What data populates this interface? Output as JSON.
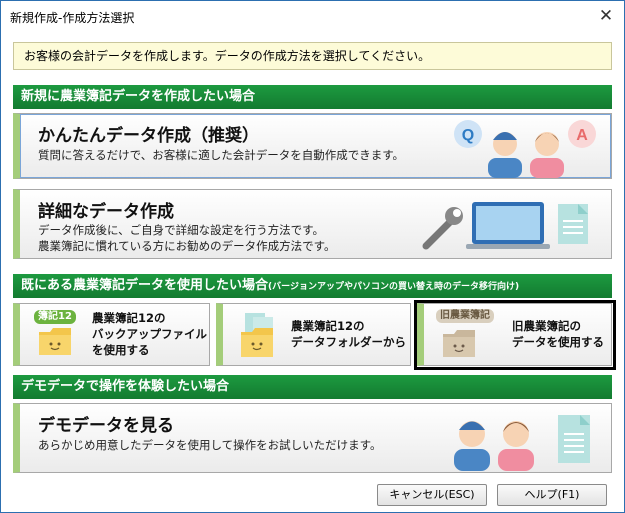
{
  "window": {
    "title": "新規作成-作成方法選択"
  },
  "info_text": "お客様の会計データを作成します。データの作成方法を選択してください。",
  "sections": {
    "new": "新規に農業簿記データを作成したい場合",
    "existing_main": "既にある農業簿記データを使用したい場合",
    "existing_note": "(バージョンアップやパソコンの買い替え時のデータ移行向け)",
    "demo": "デモデータで操作を体験したい場合"
  },
  "easy": {
    "title": "かんたんデータ作成（推奨）",
    "desc": "質問に答えるだけで、お客様に適した会計データを自動作成できます。"
  },
  "detail": {
    "title": "詳細なデータ作成",
    "desc1": "データ作成後に、ご自身で詳細な設定を行う方法です。",
    "desc2": "農業簿記に慣れている方にお勧めのデータ作成方法です。"
  },
  "backup": {
    "badge": "簿記12",
    "line1": "農業簿記12の",
    "line2": "バックアップファイル",
    "line3": "を使用する"
  },
  "folder": {
    "line1": "農業簿記12の",
    "line2": "データフォルダーから"
  },
  "old": {
    "badge": "旧農業簿記",
    "line1": "旧農業簿記の",
    "line2": "データを使用する"
  },
  "demo": {
    "title": "デモデータを見る",
    "desc": "あらかじめ用意したデータを使用して操作をお試しいただけます。"
  },
  "footer": {
    "cancel": "キャンセル(ESC)",
    "help": "ヘルプ(F1)"
  },
  "colors": {
    "section_green": "#178a37",
    "accent_green": "#a4cd7a",
    "info_bg": "#fdfbd8"
  },
  "icons": {
    "close": "✕"
  }
}
